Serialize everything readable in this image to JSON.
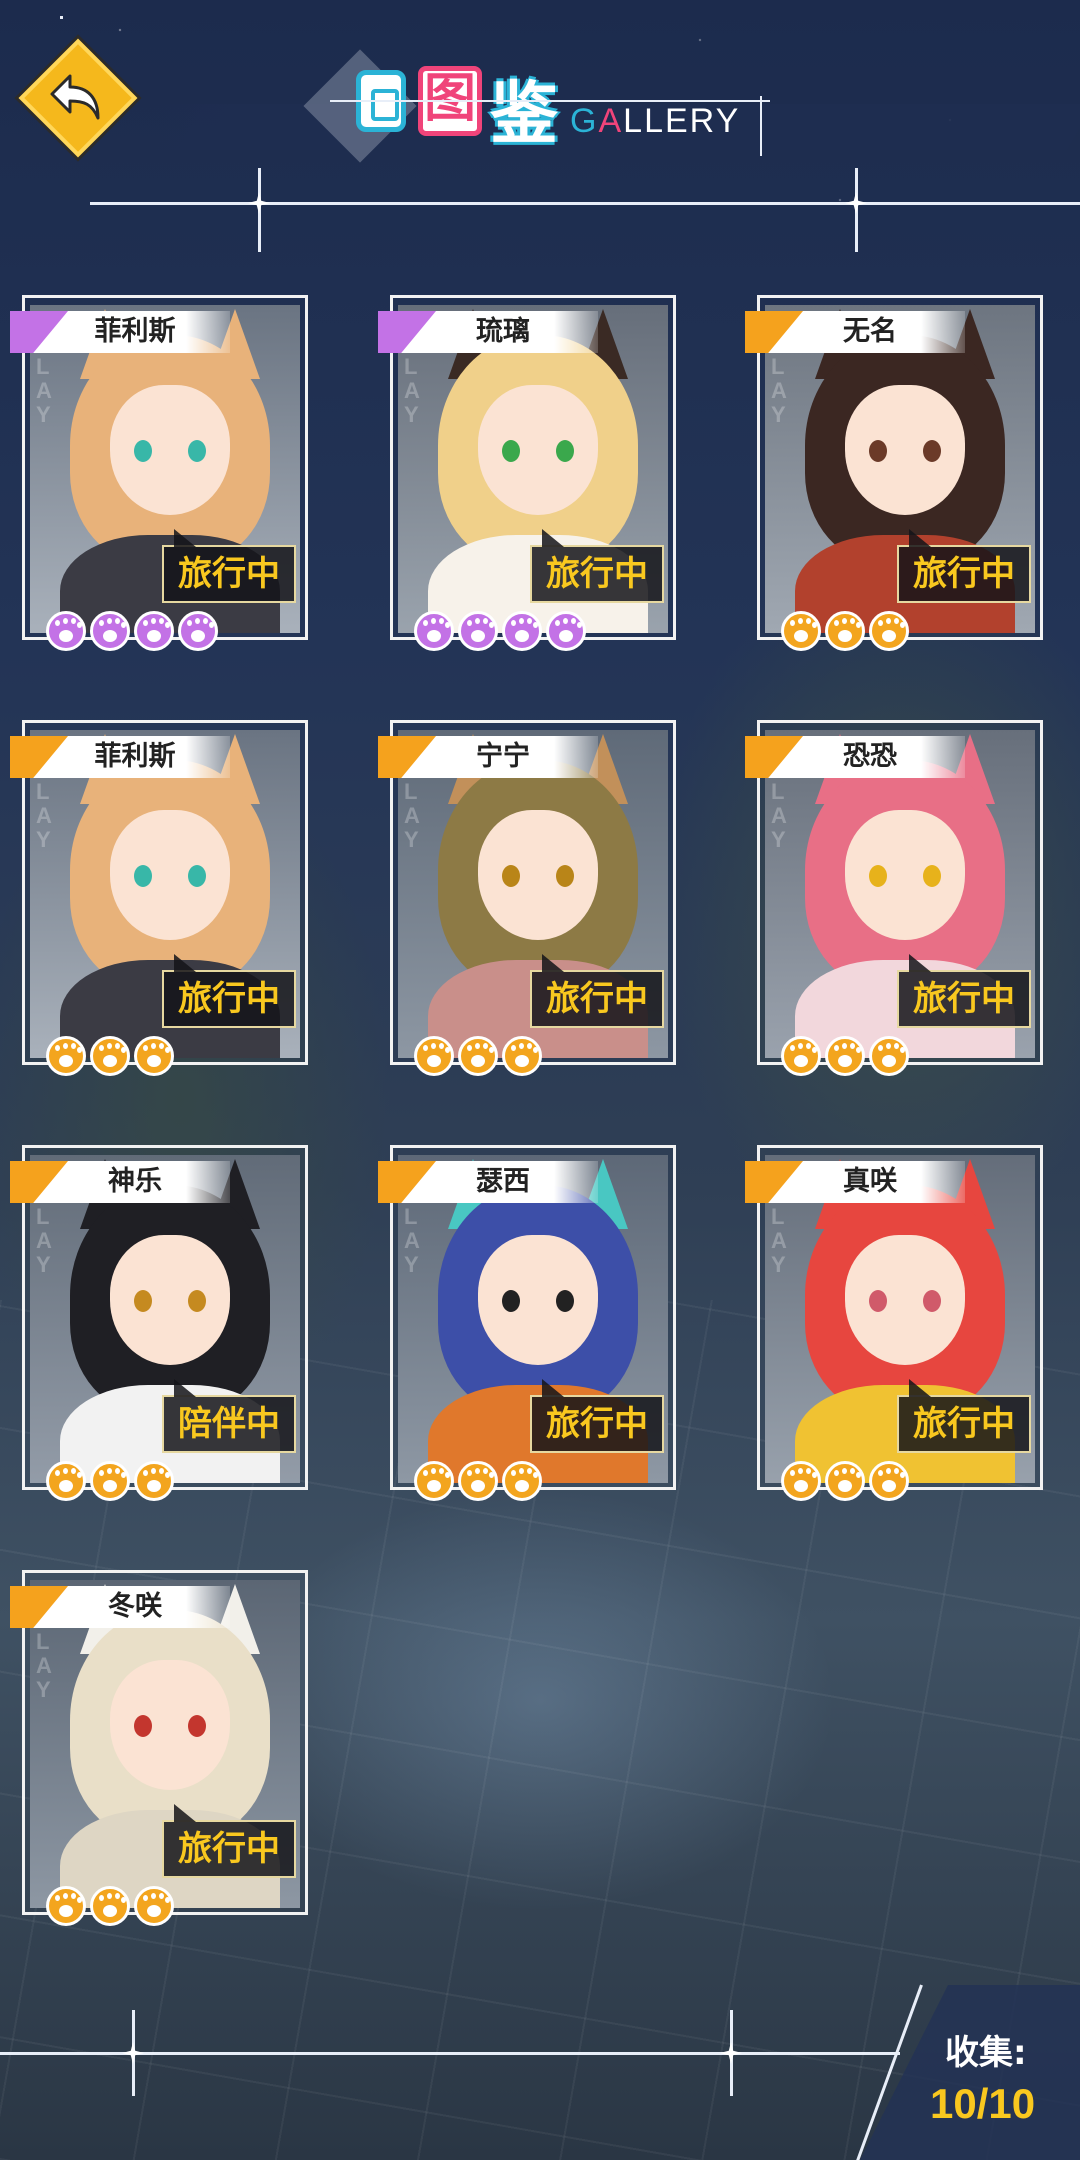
{
  "header": {
    "title_icon": "card-icon",
    "title_char_1": "图",
    "title_char_2": "鉴",
    "title_en": "GALLERY",
    "back_icon": "back-arrow-icon"
  },
  "colors": {
    "gold": "#f9c81f",
    "purple_rank": "#c372e6",
    "orange_rank": "#f5a21d",
    "title_blue": "#2bb3d6",
    "title_pink": "#f0447a"
  },
  "characters": [
    {
      "name": "菲利斯",
      "status": "旅行中",
      "rank": "purple",
      "paws": 4
    },
    {
      "name": "琉璃",
      "status": "旅行中",
      "rank": "purple",
      "paws": 4
    },
    {
      "name": "无名",
      "status": "旅行中",
      "rank": "orange",
      "paws": 3
    },
    {
      "name": "菲利斯",
      "status": "旅行中",
      "rank": "orange",
      "paws": 3
    },
    {
      "name": "宁宁",
      "status": "旅行中",
      "rank": "orange",
      "paws": 3
    },
    {
      "name": "恐恐",
      "status": "旅行中",
      "rank": "orange",
      "paws": 3
    },
    {
      "name": "神乐",
      "status": "陪伴中",
      "rank": "orange",
      "paws": 3
    },
    {
      "name": "瑟西",
      "status": "旅行中",
      "rank": "orange",
      "paws": 3
    },
    {
      "name": "真咲",
      "status": "旅行中",
      "rank": "orange",
      "paws": 3
    },
    {
      "name": "冬咲",
      "status": "旅行中",
      "rank": "orange",
      "paws": 3
    }
  ],
  "collection": {
    "label": "收集:",
    "value": "10/10"
  }
}
